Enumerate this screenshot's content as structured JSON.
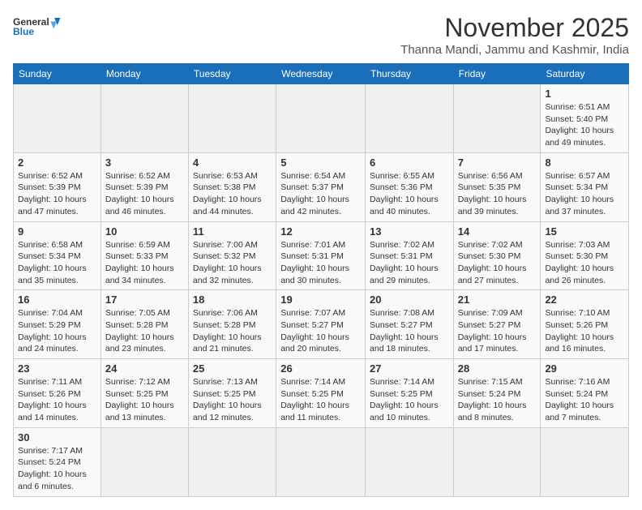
{
  "header": {
    "logo_general": "General",
    "logo_blue": "Blue",
    "month_title": "November 2025",
    "subtitle": "Thanna Mandi, Jammu and Kashmir, India"
  },
  "weekdays": [
    "Sunday",
    "Monday",
    "Tuesday",
    "Wednesday",
    "Thursday",
    "Friday",
    "Saturday"
  ],
  "days": [
    {
      "num": "",
      "sunrise": "",
      "sunset": "",
      "daylight": ""
    },
    {
      "num": "",
      "sunrise": "",
      "sunset": "",
      "daylight": ""
    },
    {
      "num": "",
      "sunrise": "",
      "sunset": "",
      "daylight": ""
    },
    {
      "num": "",
      "sunrise": "",
      "sunset": "",
      "daylight": ""
    },
    {
      "num": "",
      "sunrise": "",
      "sunset": "",
      "daylight": ""
    },
    {
      "num": "",
      "sunrise": "",
      "sunset": "",
      "daylight": ""
    },
    {
      "num": "1",
      "sunrise": "6:51 AM",
      "sunset": "5:40 PM",
      "daylight": "10 hours and 49 minutes."
    },
    {
      "num": "2",
      "sunrise": "6:52 AM",
      "sunset": "5:39 PM",
      "daylight": "10 hours and 47 minutes."
    },
    {
      "num": "3",
      "sunrise": "6:52 AM",
      "sunset": "5:39 PM",
      "daylight": "10 hours and 46 minutes."
    },
    {
      "num": "4",
      "sunrise": "6:53 AM",
      "sunset": "5:38 PM",
      "daylight": "10 hours and 44 minutes."
    },
    {
      "num": "5",
      "sunrise": "6:54 AM",
      "sunset": "5:37 PM",
      "daylight": "10 hours and 42 minutes."
    },
    {
      "num": "6",
      "sunrise": "6:55 AM",
      "sunset": "5:36 PM",
      "daylight": "10 hours and 40 minutes."
    },
    {
      "num": "7",
      "sunrise": "6:56 AM",
      "sunset": "5:35 PM",
      "daylight": "10 hours and 39 minutes."
    },
    {
      "num": "8",
      "sunrise": "6:57 AM",
      "sunset": "5:34 PM",
      "daylight": "10 hours and 37 minutes."
    },
    {
      "num": "9",
      "sunrise": "6:58 AM",
      "sunset": "5:34 PM",
      "daylight": "10 hours and 35 minutes."
    },
    {
      "num": "10",
      "sunrise": "6:59 AM",
      "sunset": "5:33 PM",
      "daylight": "10 hours and 34 minutes."
    },
    {
      "num": "11",
      "sunrise": "7:00 AM",
      "sunset": "5:32 PM",
      "daylight": "10 hours and 32 minutes."
    },
    {
      "num": "12",
      "sunrise": "7:01 AM",
      "sunset": "5:31 PM",
      "daylight": "10 hours and 30 minutes."
    },
    {
      "num": "13",
      "sunrise": "7:02 AM",
      "sunset": "5:31 PM",
      "daylight": "10 hours and 29 minutes."
    },
    {
      "num": "14",
      "sunrise": "7:02 AM",
      "sunset": "5:30 PM",
      "daylight": "10 hours and 27 minutes."
    },
    {
      "num": "15",
      "sunrise": "7:03 AM",
      "sunset": "5:30 PM",
      "daylight": "10 hours and 26 minutes."
    },
    {
      "num": "16",
      "sunrise": "7:04 AM",
      "sunset": "5:29 PM",
      "daylight": "10 hours and 24 minutes."
    },
    {
      "num": "17",
      "sunrise": "7:05 AM",
      "sunset": "5:28 PM",
      "daylight": "10 hours and 23 minutes."
    },
    {
      "num": "18",
      "sunrise": "7:06 AM",
      "sunset": "5:28 PM",
      "daylight": "10 hours and 21 minutes."
    },
    {
      "num": "19",
      "sunrise": "7:07 AM",
      "sunset": "5:27 PM",
      "daylight": "10 hours and 20 minutes."
    },
    {
      "num": "20",
      "sunrise": "7:08 AM",
      "sunset": "5:27 PM",
      "daylight": "10 hours and 18 minutes."
    },
    {
      "num": "21",
      "sunrise": "7:09 AM",
      "sunset": "5:27 PM",
      "daylight": "10 hours and 17 minutes."
    },
    {
      "num": "22",
      "sunrise": "7:10 AM",
      "sunset": "5:26 PM",
      "daylight": "10 hours and 16 minutes."
    },
    {
      "num": "23",
      "sunrise": "7:11 AM",
      "sunset": "5:26 PM",
      "daylight": "10 hours and 14 minutes."
    },
    {
      "num": "24",
      "sunrise": "7:12 AM",
      "sunset": "5:25 PM",
      "daylight": "10 hours and 13 minutes."
    },
    {
      "num": "25",
      "sunrise": "7:13 AM",
      "sunset": "5:25 PM",
      "daylight": "10 hours and 12 minutes."
    },
    {
      "num": "26",
      "sunrise": "7:14 AM",
      "sunset": "5:25 PM",
      "daylight": "10 hours and 11 minutes."
    },
    {
      "num": "27",
      "sunrise": "7:14 AM",
      "sunset": "5:25 PM",
      "daylight": "10 hours and 10 minutes."
    },
    {
      "num": "28",
      "sunrise": "7:15 AM",
      "sunset": "5:24 PM",
      "daylight": "10 hours and 8 minutes."
    },
    {
      "num": "29",
      "sunrise": "7:16 AM",
      "sunset": "5:24 PM",
      "daylight": "10 hours and 7 minutes."
    },
    {
      "num": "30",
      "sunrise": "7:17 AM",
      "sunset": "5:24 PM",
      "daylight": "10 hours and 6 minutes."
    },
    {
      "num": "",
      "sunrise": "",
      "sunset": "",
      "daylight": ""
    },
    {
      "num": "",
      "sunrise": "",
      "sunset": "",
      "daylight": ""
    },
    {
      "num": "",
      "sunrise": "",
      "sunset": "",
      "daylight": ""
    },
    {
      "num": "",
      "sunrise": "",
      "sunset": "",
      "daylight": ""
    },
    {
      "num": "",
      "sunrise": "",
      "sunset": "",
      "daylight": ""
    },
    {
      "num": "",
      "sunrise": "",
      "sunset": "",
      "daylight": ""
    }
  ]
}
